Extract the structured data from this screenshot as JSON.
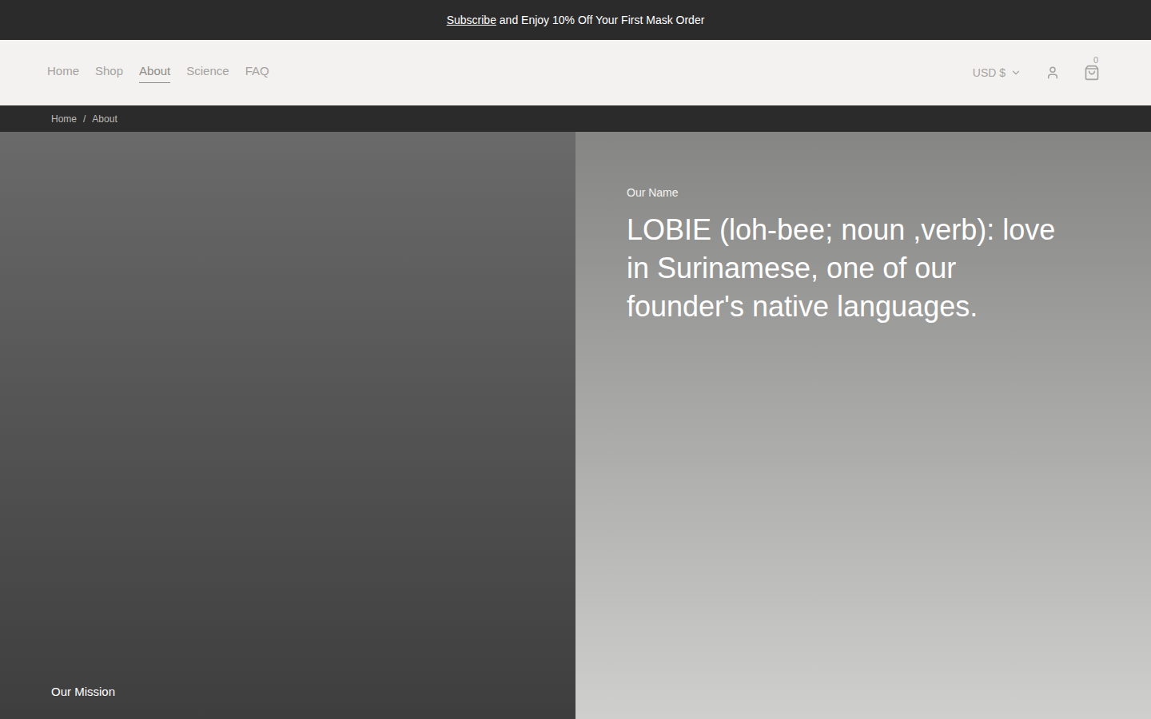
{
  "announcement": {
    "link": "Subscribe",
    "text": " and Enjoy 10% Off Your First Mask Order"
  },
  "nav": [
    {
      "label": "Home",
      "selected": false
    },
    {
      "label": "Shop",
      "selected": false
    },
    {
      "label": "About",
      "selected": true
    },
    {
      "label": "Science",
      "selected": false
    },
    {
      "label": "FAQ",
      "selected": false
    }
  ],
  "currency": "USD $",
  "cart": {
    "count": "0"
  },
  "breadcrumb": {
    "items": [
      "Home",
      "About"
    ],
    "separator": "/"
  },
  "mission": {
    "label": "Our Mission"
  },
  "name": {
    "label": "Our Name",
    "text": "LOBIE (loh-bee; noun ,verb): love in Surinamese, one of our founder's native languages."
  }
}
